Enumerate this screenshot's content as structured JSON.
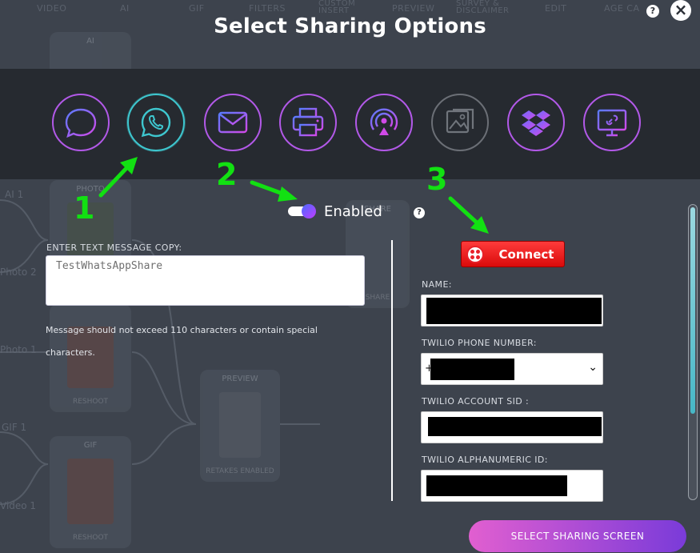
{
  "background": {
    "nav": [
      "VIDEO",
      "AI",
      "GIF",
      "FILTERS",
      "CUSTOM INSERT",
      "PREVIEW",
      "SURVEY & DISCLAIMER",
      "EDIT",
      "AGE CA"
    ],
    "cards": [
      {
        "title": "AI",
        "foot": ""
      },
      {
        "title": "PHOTO",
        "foot": ""
      },
      {
        "title": "",
        "foot": "RESHOOT"
      },
      {
        "title": "PREVIEW",
        "foot": "RETAKES ENABLED"
      },
      {
        "title": "GIF",
        "foot": "RESHOOT"
      },
      {
        "title": "SHARE",
        "foot": "SHARE"
      }
    ],
    "labels": [
      "AI 1",
      "Photo 2",
      "Photo 1",
      "GIF 1",
      "Video 1"
    ]
  },
  "modal": {
    "title": "Select Sharing Options",
    "help": "?",
    "close": "×"
  },
  "share_options": [
    {
      "name": "sms",
      "icon": "chat-bubble-icon",
      "state": "normal"
    },
    {
      "name": "whatsapp",
      "icon": "whatsapp-icon",
      "state": "active"
    },
    {
      "name": "email",
      "icon": "envelope-icon",
      "state": "normal"
    },
    {
      "name": "print",
      "icon": "printer-icon",
      "state": "normal"
    },
    {
      "name": "airdrop",
      "icon": "airdrop-icon",
      "state": "normal"
    },
    {
      "name": "gallery",
      "icon": "gallery-icon",
      "state": "disabled"
    },
    {
      "name": "dropbox",
      "icon": "dropbox-icon",
      "state": "normal"
    },
    {
      "name": "link",
      "icon": "screen-link-icon",
      "state": "normal"
    }
  ],
  "annotations": {
    "one": "1",
    "two": "2",
    "three": "3"
  },
  "toggle": {
    "label": "Enabled",
    "on": true,
    "help": "?"
  },
  "message": {
    "label": "ENTER TEXT MESSAGE COPY:",
    "value": "TestWhatsAppShare",
    "hint": "Message should not exceed 110 characters or contain special characters."
  },
  "twilio": {
    "connect_label": "Connect",
    "name_label": "NAME:",
    "phone_label": "TWILIO PHONE NUMBER:",
    "phone_prefix": "+",
    "sid_label": "TWILIO ACCOUNT SID :",
    "alpha_label": "TWILIO ALPHANUMERIC ID:"
  },
  "footer": {
    "button": "SELECT SHARING SCREEN"
  },
  "colors": {
    "accent": "#b259e8",
    "active": "#3ec7cf",
    "annotation": "#12e012",
    "connect": "#e8222a"
  }
}
